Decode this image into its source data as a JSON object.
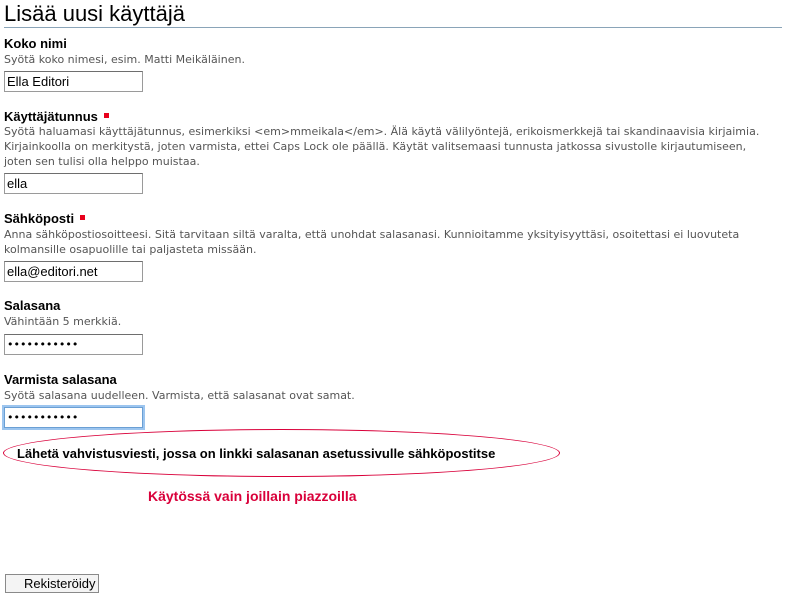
{
  "page": {
    "title": "Lisää uusi käyttäjä"
  },
  "fields": {
    "full_name": {
      "label": "Koko nimi",
      "description": "Syötä koko nimesi, esim. Matti Meikäläinen.",
      "value": "Ella Editori",
      "required": false
    },
    "username": {
      "label": "Käyttäjätunnus",
      "description": "Syötä haluamasi käyttäjätunnus, esimerkiksi <em>mmeikala</em>. Älä käytä välilyöntejä, erikoismerkkejä tai skandinaavisia kirjaimia. Kirjainkoolla on merkitystä, joten varmista, ettei Caps Lock ole päällä. Käytät valitsemaasi tunnusta jatkossa sivustolle kirjautumiseen, joten sen tulisi olla helppo muistaa.",
      "value": "ella",
      "required": true
    },
    "email": {
      "label": "Sähköposti",
      "description": "Anna sähköpostiosoitteesi. Sitä tarvitaan siltä varalta, että unohdat salasanasi. Kunnioitamme yksityisyyttäsi, osoitettasi ei luovuteta kolmansille osapuolille tai paljasteta missään.",
      "value": "ella@editori.net",
      "required": true
    },
    "password": {
      "label": "Salasana",
      "description": "Vähintään 5 merkkiä.",
      "value": "•••••••••••",
      "required": false
    },
    "confirm_password": {
      "label": "Varmista salasana",
      "description": "Syötä salasana uudelleen. Varmista, että salasanat ovat samat.",
      "value": "•••••••••••",
      "required": false
    }
  },
  "reset_link_option": {
    "label": "Lähetä vahvistusviesti, jossa on linkki salasanan asetussivulle sähköpostitse",
    "annotation_color": "#d9003a"
  },
  "annotation": {
    "text": "Käytössä vain joillain piazzoilla"
  },
  "submit": {
    "label": "Rekisteröidy"
  },
  "colors": {
    "required_marker": "#e8001c",
    "annotation": "#d9003a",
    "title_rule": "#8aa4b8",
    "description_text": "#555555"
  }
}
